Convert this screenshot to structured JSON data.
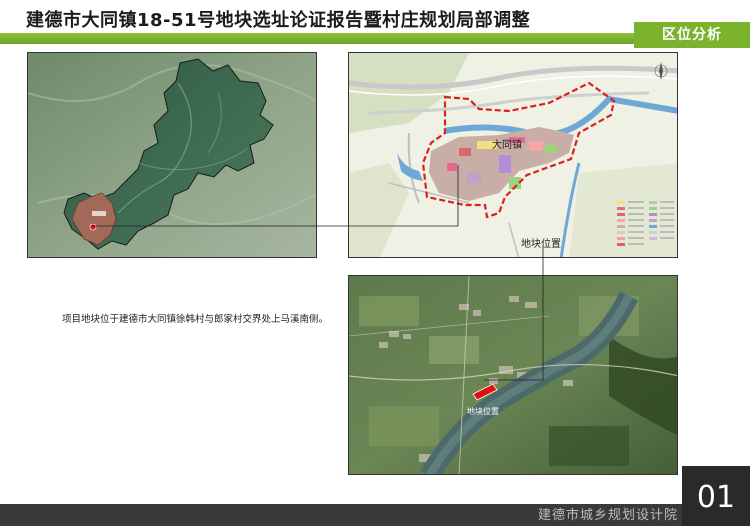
{
  "header": {
    "title": "建德市大同镇18-51号地块选址论证报告暨村庄规划局部调整",
    "section": "区位分析"
  },
  "maps": {
    "town_label": "大同镇",
    "site_location_label": "地块位置",
    "site_label_photo": "地块位置"
  },
  "description": {
    "text": "项目地块位于建德市大同镇徐韩村与郎家村交界处上马溪南侧。"
  },
  "footer": {
    "org": "建德市城乡规划设计院",
    "page": "01"
  },
  "colors": {
    "accent_green": "#7bb32e",
    "boundary_red": "#d9211e",
    "site_red": "#e01010"
  }
}
